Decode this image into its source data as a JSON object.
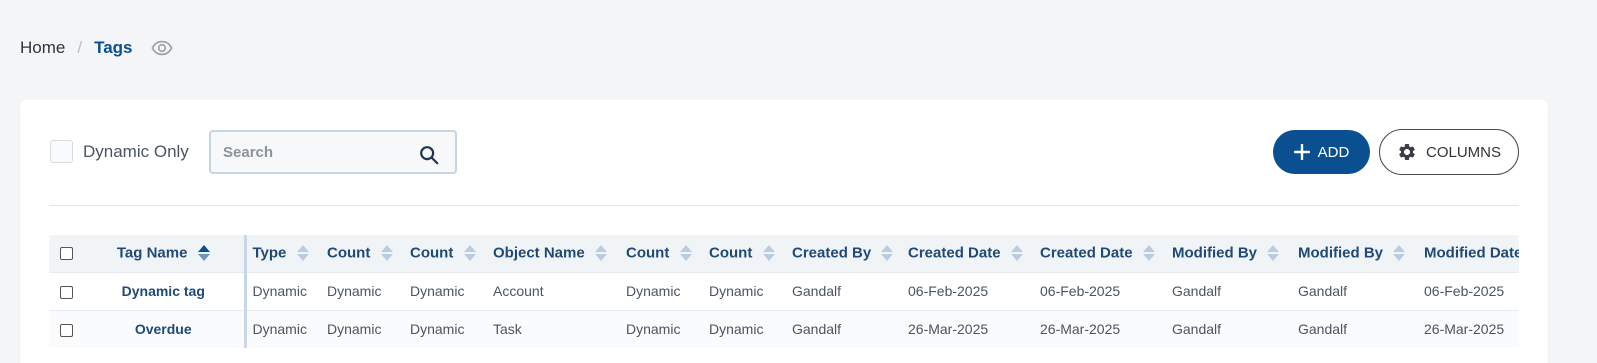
{
  "breadcrumb": {
    "home": "Home",
    "separator": "/",
    "current": "Tags",
    "icon": "eye-icon"
  },
  "toolbar": {
    "dynamic_only_label": "Dynamic Only",
    "dynamic_only_checked": false,
    "search_placeholder": "Search",
    "search_value": "",
    "add_label": "ADD",
    "columns_label": "COLUMNS"
  },
  "colors": {
    "primary": "#0a4f8f",
    "header_text": "#1f4a75",
    "page_bg": "#f4f5f7"
  },
  "table": {
    "columns": [
      {
        "key": "tag_name",
        "label": "Tag Name",
        "sort": "ascending"
      },
      {
        "key": "type",
        "label": "Type"
      },
      {
        "key": "count1",
        "label": "Count"
      },
      {
        "key": "count2",
        "label": "Count"
      },
      {
        "key": "object_name",
        "label": "Object Name"
      },
      {
        "key": "count3",
        "label": "Count"
      },
      {
        "key": "count4",
        "label": "Count"
      },
      {
        "key": "created_by",
        "label": "Created By"
      },
      {
        "key": "created_date1",
        "label": "Created Date"
      },
      {
        "key": "created_date2",
        "label": "Created Date"
      },
      {
        "key": "modified_by1",
        "label": "Modified By"
      },
      {
        "key": "modified_by2",
        "label": "Modified By"
      },
      {
        "key": "modified_date",
        "label": "Modified Date"
      }
    ],
    "rows": [
      {
        "cells": [
          "Dynamic tag",
          "Dynamic",
          "Dynamic",
          "Dynamic",
          "Account",
          "Dynamic",
          "Dynamic",
          "Gandalf",
          "06-Feb-2025",
          "06-Feb-2025",
          "Gandalf",
          "Gandalf",
          "06-Feb-2025"
        ]
      },
      {
        "cells": [
          "Overdue",
          "Dynamic",
          "Dynamic",
          "Dynamic",
          "Task",
          "Dynamic",
          "Dynamic",
          "Gandalf",
          "26-Mar-2025",
          "26-Mar-2025",
          "Gandalf",
          "Gandalf",
          "26-Mar-2025"
        ]
      }
    ]
  }
}
